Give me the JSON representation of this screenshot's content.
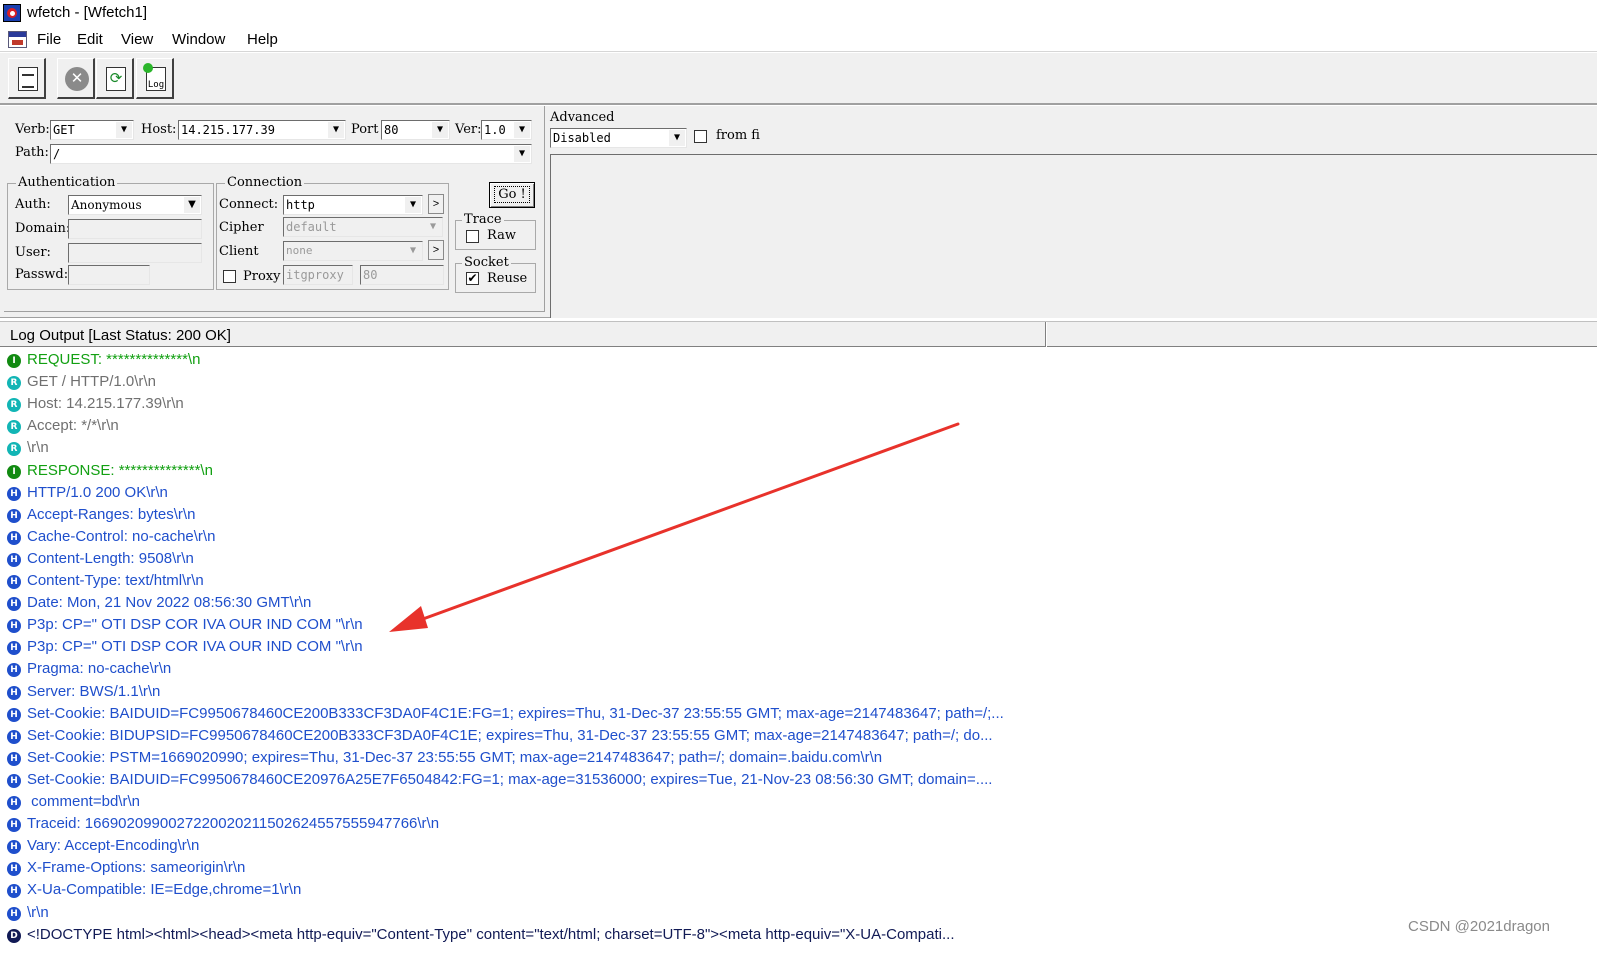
{
  "window": {
    "title": "wfetch - [Wfetch1]"
  },
  "menu": [
    "File",
    "Edit",
    "View",
    "Window",
    "Help"
  ],
  "toolbar": {
    "log_icon_text": "Log"
  },
  "request": {
    "verb_label": "Verb:",
    "verb_value": "GET",
    "host_label": "Host:",
    "host_value": "14.215.177.39",
    "port_label": "Port",
    "port_value": "80",
    "ver_label": "Ver:",
    "ver_value": "1.0",
    "path_label": "Path:",
    "path_value": "/"
  },
  "advanced": {
    "label": "Advanced",
    "value": "Disabled",
    "from_file_label": "from fi"
  },
  "authentication": {
    "title": "Authentication",
    "auth_label": "Auth:",
    "auth_value": "Anonymous",
    "domain_label": "Domain:",
    "user_label": "User:",
    "passwd_label": "Passwd:"
  },
  "connection": {
    "title": "Connection",
    "connect_label": "Connect:",
    "connect_value": "http",
    "cipher_label": "Cipher",
    "cipher_value": "default",
    "client_label": "Client",
    "client_value": "none",
    "proxy_label": "Proxy",
    "proxy_value": "itgproxy",
    "proxy_port": "80"
  },
  "go_label": "Go !",
  "trace": {
    "title": "Trace",
    "raw_label": "Raw"
  },
  "socket": {
    "title": "Socket",
    "reuse_label": "Reuse",
    "reuse_checked": "✔"
  },
  "log": {
    "title": "Log Output [Last Status: 200 OK]",
    "lines": [
      {
        "type": "I",
        "text": "REQUEST: **************\\n",
        "color": "#12a012"
      },
      {
        "type": "R",
        "text": "GET / HTTP/1.0\\r\\n",
        "color": "#707070"
      },
      {
        "type": "R",
        "text": "Host: 14.215.177.39\\r\\n",
        "color": "#707070"
      },
      {
        "type": "R",
        "text": "Accept: */*\\r\\n",
        "color": "#707070"
      },
      {
        "type": "R",
        "text": "\\r\\n",
        "color": "#707070"
      },
      {
        "type": "I",
        "text": "RESPONSE: **************\\n",
        "color": "#12a012"
      },
      {
        "type": "H",
        "text": "HTTP/1.0 200 OK\\r\\n",
        "color": "#1f4fcc"
      },
      {
        "type": "H",
        "text": "Accept-Ranges: bytes\\r\\n",
        "color": "#1f4fcc"
      },
      {
        "type": "H",
        "text": "Cache-Control: no-cache\\r\\n",
        "color": "#1f4fcc"
      },
      {
        "type": "H",
        "text": "Content-Length: 9508\\r\\n",
        "color": "#1f4fcc"
      },
      {
        "type": "H",
        "text": "Content-Type: text/html\\r\\n",
        "color": "#1f4fcc"
      },
      {
        "type": "H",
        "text": "Date: Mon, 21 Nov 2022 08:56:30 GMT\\r\\n",
        "color": "#1f4fcc"
      },
      {
        "type": "H",
        "text": "P3p: CP=\" OTI DSP COR IVA OUR IND COM \"\\r\\n",
        "color": "#1f4fcc"
      },
      {
        "type": "H",
        "text": "P3p: CP=\" OTI DSP COR IVA OUR IND COM \"\\r\\n",
        "color": "#1f4fcc"
      },
      {
        "type": "H",
        "text": "Pragma: no-cache\\r\\n",
        "color": "#1f4fcc"
      },
      {
        "type": "H",
        "text": "Server: BWS/1.1\\r\\n",
        "color": "#1f4fcc"
      },
      {
        "type": "H",
        "text": "Set-Cookie: BAIDUID=FC9950678460CE200B333CF3DA0F4C1E:FG=1; expires=Thu, 31-Dec-37 23:55:55 GMT; max-age=2147483647; path=/;...",
        "color": "#1f4fcc"
      },
      {
        "type": "H",
        "text": "Set-Cookie: BIDUPSID=FC9950678460CE200B333CF3DA0F4C1E; expires=Thu, 31-Dec-37 23:55:55 GMT; max-age=2147483647; path=/; do...",
        "color": "#1f4fcc"
      },
      {
        "type": "H",
        "text": "Set-Cookie: PSTM=1669020990; expires=Thu, 31-Dec-37 23:55:55 GMT; max-age=2147483647; path=/; domain=.baidu.com\\r\\n",
        "color": "#1f4fcc"
      },
      {
        "type": "H",
        "text": "Set-Cookie: BAIDUID=FC9950678460CE20976A25E7F6504842:FG=1; max-age=31536000; expires=Tue, 21-Nov-23 08:56:30 GMT; domain=....",
        "color": "#1f4fcc"
      },
      {
        "type": "H",
        "text": " comment=bd\\r\\n",
        "color": "#1f4fcc"
      },
      {
        "type": "H",
        "text": "Traceid: 1669020990027220020211502624557555947766\\r\\n",
        "color": "#1f4fcc"
      },
      {
        "type": "H",
        "text": "Vary: Accept-Encoding\\r\\n",
        "color": "#1f4fcc"
      },
      {
        "type": "H",
        "text": "X-Frame-Options: sameorigin\\r\\n",
        "color": "#1f4fcc"
      },
      {
        "type": "H",
        "text": "X-Ua-Compatible: IE=Edge,chrome=1\\r\\n",
        "color": "#1f4fcc"
      },
      {
        "type": "H",
        "text": "\\r\\n",
        "color": "#1f4fcc"
      },
      {
        "type": "D",
        "text": "<!DOCTYPE html><html><head><meta http-equiv=\"Content-Type\" content=\"text/html; charset=UTF-8\"><meta http-equiv=\"X-UA-Compati...",
        "color": "#111a55"
      }
    ]
  },
  "colors": {
    "annotation_arrow": "#e8322b"
  },
  "watermark": "CSDN @2021dragon"
}
